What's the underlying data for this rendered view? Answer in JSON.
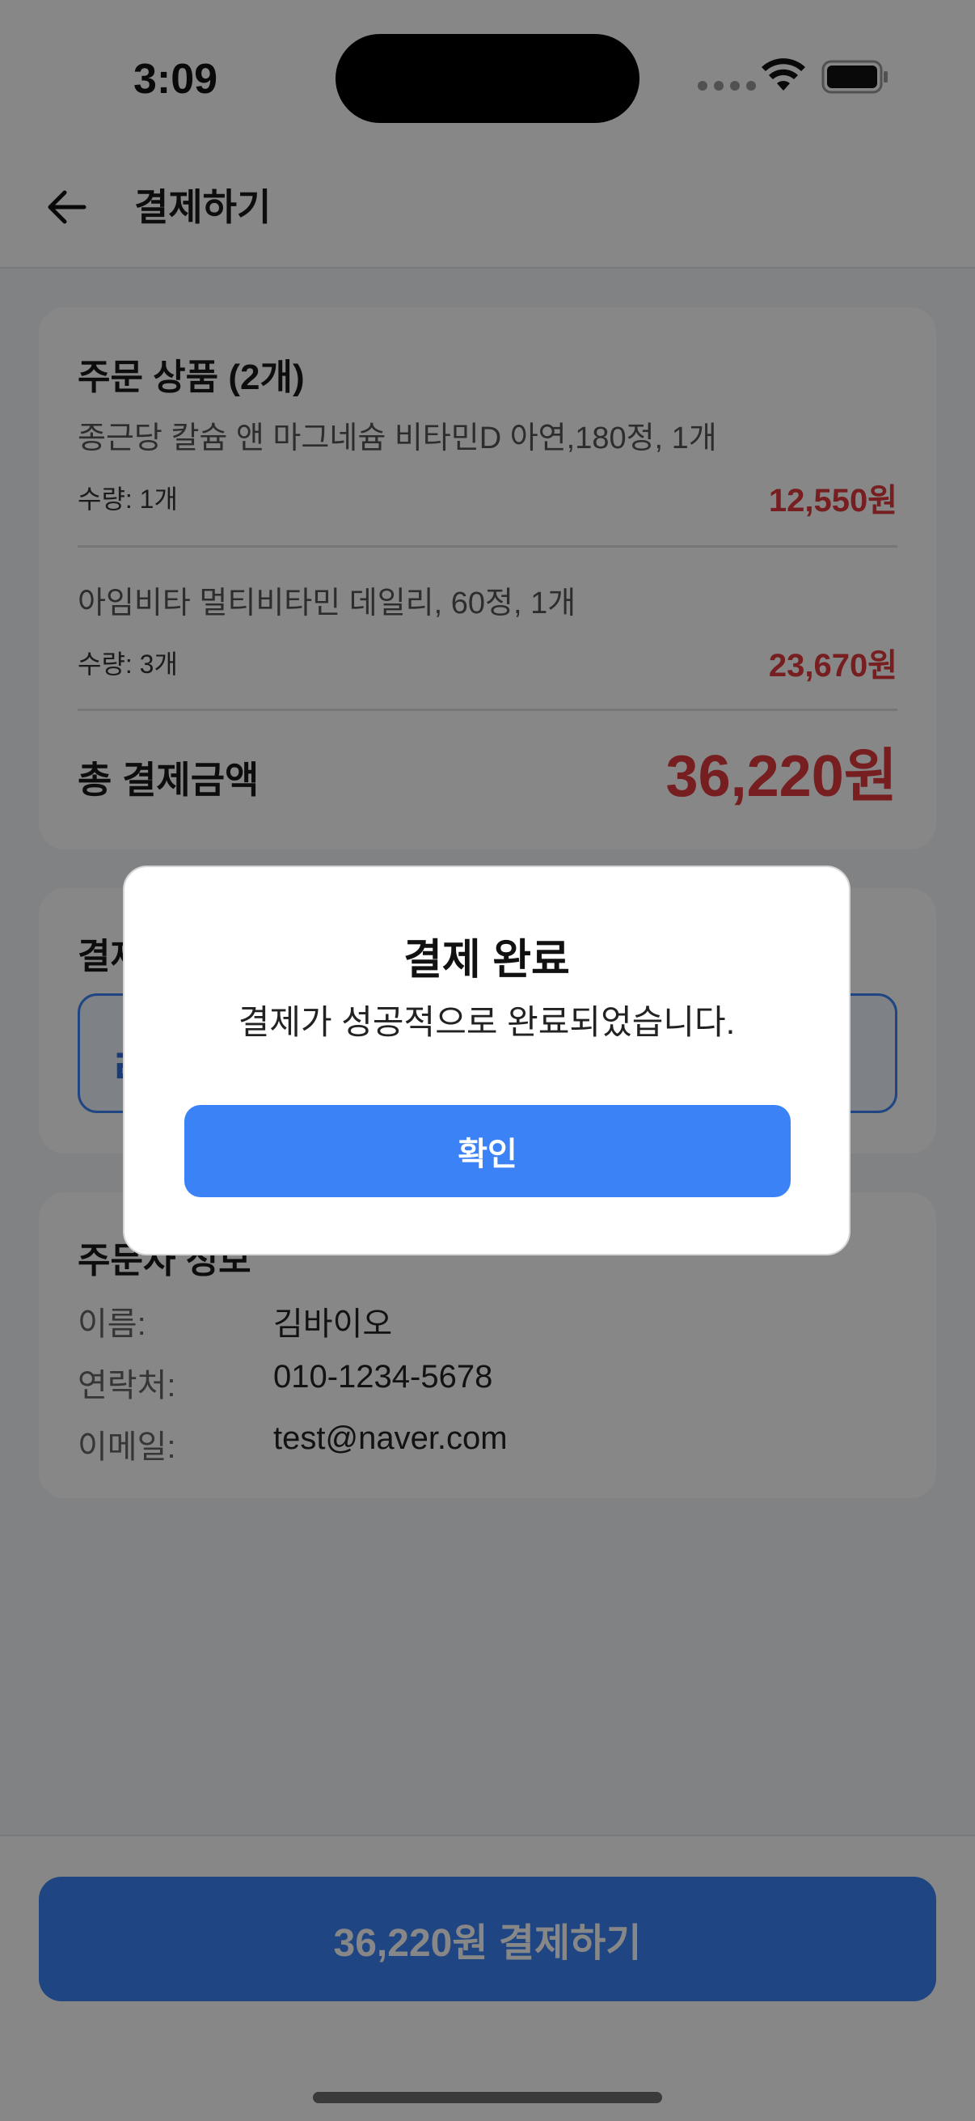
{
  "status_bar": {
    "time": "3:09"
  },
  "header": {
    "title": "결제하기"
  },
  "order": {
    "title": "주문 상품 (2개)",
    "items": [
      {
        "name": "종근당 칼슘 앤 마그네슘 비타민D 아연,180정, 1개",
        "qty": "수량: 1개",
        "price": "12,550원"
      },
      {
        "name": "아임비타 멀티비타민 데일리, 60정, 1개",
        "qty": "수량: 3개",
        "price": "23,670원"
      }
    ],
    "total_label": "총 결제금액",
    "total_value": "36,220원"
  },
  "payment_method": {
    "title_partial": "결제",
    "option_mark_partial": "ㄹ"
  },
  "buyer": {
    "title": "주문자 정보",
    "rows": [
      {
        "label": "이름:",
        "value": "김바이오"
      },
      {
        "label": "연락처:",
        "value": "010-1234-5678"
      },
      {
        "label": "이메일:",
        "value": "test@naver.com"
      }
    ]
  },
  "bottom": {
    "pay_button_label": "36,220원 결제하기"
  },
  "dialog": {
    "title": "결제 완료",
    "message": "결제가 성공적으로 완료되었습니다.",
    "confirm_label": "확인"
  },
  "colors": {
    "accent": "#3b82f6",
    "price": "#e0393e",
    "overlay": "rgba(0,0,0,0.47)"
  },
  "icons": [
    "wifi-icon",
    "battery-icon",
    "back-arrow-icon"
  ]
}
